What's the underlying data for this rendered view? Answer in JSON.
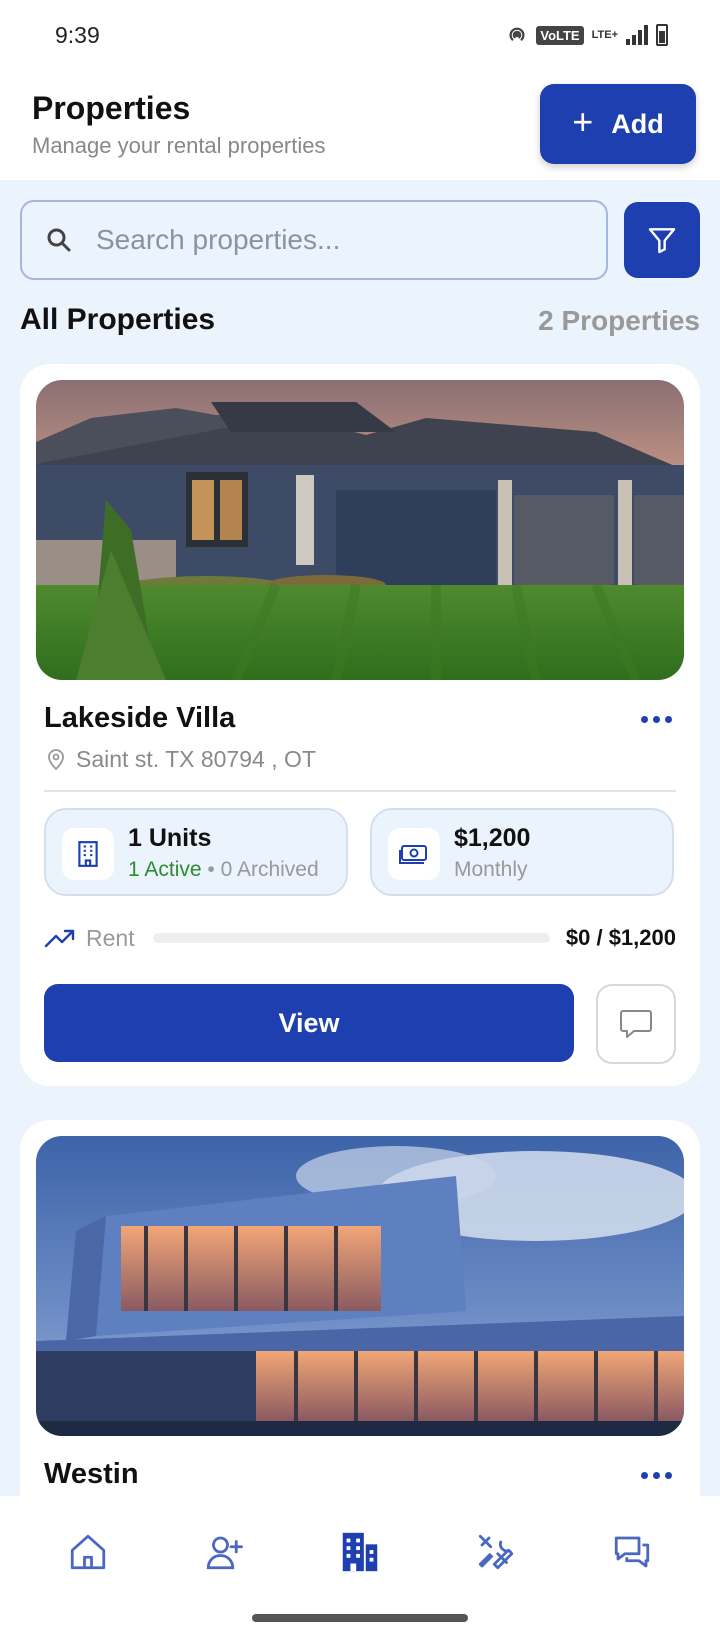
{
  "status_bar": {
    "time": "9:39",
    "volte": "VoLTE",
    "lte": "LTE+"
  },
  "header": {
    "title": "Properties",
    "subtitle": "Manage your rental properties",
    "add_label": "Add"
  },
  "search": {
    "placeholder": "Search properties..."
  },
  "section": {
    "title": "All Properties",
    "count": "2 Properties"
  },
  "properties": [
    {
      "name": "Lakeside Villa",
      "address": "Saint st. TX 80794 , OT",
      "units": "1 Units",
      "active": "1 Active",
      "separator": "•",
      "archived": "0 Archived",
      "rent": "$1,200",
      "rent_period": "Monthly",
      "rent_label": "Rent",
      "rent_amount": "$0 / $1,200",
      "rent_progress": 0,
      "view_label": "View"
    },
    {
      "name": "Westin"
    }
  ],
  "nav": {
    "items": [
      "home-icon",
      "add-tenant-icon",
      "properties-icon",
      "maintenance-icon",
      "messages-icon"
    ],
    "active": "properties-icon"
  },
  "colors": {
    "primary": "#1d3faf",
    "background": "#ebf3fc",
    "active_green": "#2e8b2e"
  }
}
